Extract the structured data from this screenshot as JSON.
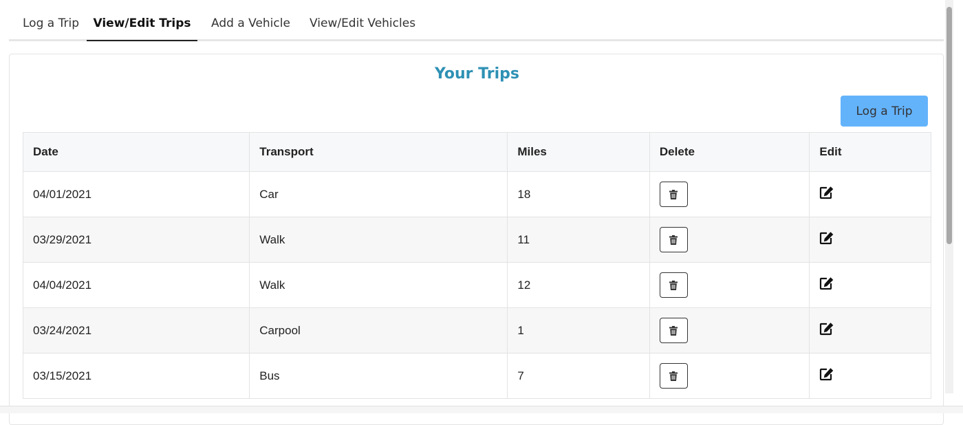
{
  "tabs": [
    {
      "label": "Log a Trip"
    },
    {
      "label": "View/Edit Trips"
    },
    {
      "label": "Add a Vehicle"
    },
    {
      "label": "View/Edit Vehicles"
    }
  ],
  "card": {
    "title": "Your Trips",
    "log_button": "Log a Trip"
  },
  "table": {
    "headers": [
      "Date",
      "Transport",
      "Miles",
      "Delete",
      "Edit"
    ],
    "rows": [
      {
        "date": "04/01/2021",
        "transport": "Car",
        "miles": "18"
      },
      {
        "date": "03/29/2021",
        "transport": "Walk",
        "miles": "11"
      },
      {
        "date": "04/04/2021",
        "transport": "Walk",
        "miles": "12"
      },
      {
        "date": "03/24/2021",
        "transport": "Carpool",
        "miles": "1"
      },
      {
        "date": "03/15/2021",
        "transport": "Bus",
        "miles": "7"
      }
    ]
  },
  "icons": {
    "delete": "trash-icon",
    "edit": "edit-icon"
  },
  "colors": {
    "title": "#2e91b4",
    "button": "#63b3fb"
  }
}
